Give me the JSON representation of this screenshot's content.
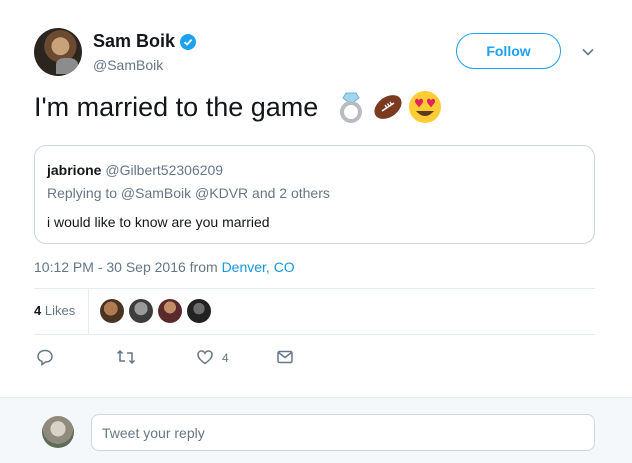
{
  "author": {
    "name": "Sam Boik",
    "handle": "@SamBoik",
    "verified": true
  },
  "follow_label": "Follow",
  "tweet": {
    "text": "I'm married to the game",
    "emojis": [
      "ring-icon",
      "football-icon",
      "heart-eyes-icon"
    ]
  },
  "quote": {
    "name": "jabrione",
    "handle": "@Gilbert52306209",
    "replying_to": "Replying to @SamBoik @KDVR and 2 others",
    "text": "i would like to know are you married"
  },
  "meta": {
    "time": "10:12 PM - 30 Sep 2016 from ",
    "location": "Denver, CO"
  },
  "likes": {
    "count": "4",
    "label": " Likes"
  },
  "actions": {
    "like_count": "4"
  },
  "reply": {
    "placeholder": "Tweet your reply"
  },
  "colors": {
    "accent": "#1da1f2",
    "text": "#14171a",
    "secondary": "#657786",
    "border": "#ccd6dd"
  }
}
